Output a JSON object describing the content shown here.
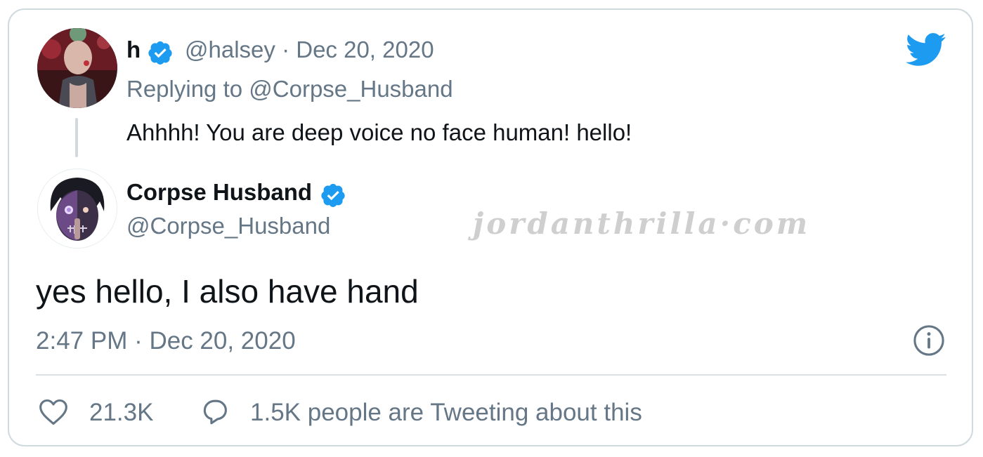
{
  "colors": {
    "accent": "#1d9bf0",
    "text": "#0f1419",
    "muted": "#657786",
    "border": "#cfd9de"
  },
  "parent_tweet": {
    "name": "h",
    "handle": "@halsey",
    "separator": "·",
    "date": "Dec 20, 2020",
    "replying_to": "Replying to @Corpse_Husband",
    "text": "Ahhhh! You are deep voice no face human! hello!",
    "verified_icon": "verified-badge-icon"
  },
  "main_tweet": {
    "name": "Corpse Husband",
    "handle": "@Corpse_Husband",
    "text": "yes hello, I also have hand",
    "timestamp": "2:47 PM · Dec 20, 2020",
    "verified_icon": "verified-badge-icon"
  },
  "watermark": "jordanthrilla·com",
  "stats": {
    "likes": "21.3K",
    "tweeting": "1.5K people are Tweeting about this"
  },
  "icons": {
    "logo": "twitter-bird-icon",
    "info": "info-icon",
    "like": "heart-icon",
    "reply": "speech-bubble-icon"
  }
}
